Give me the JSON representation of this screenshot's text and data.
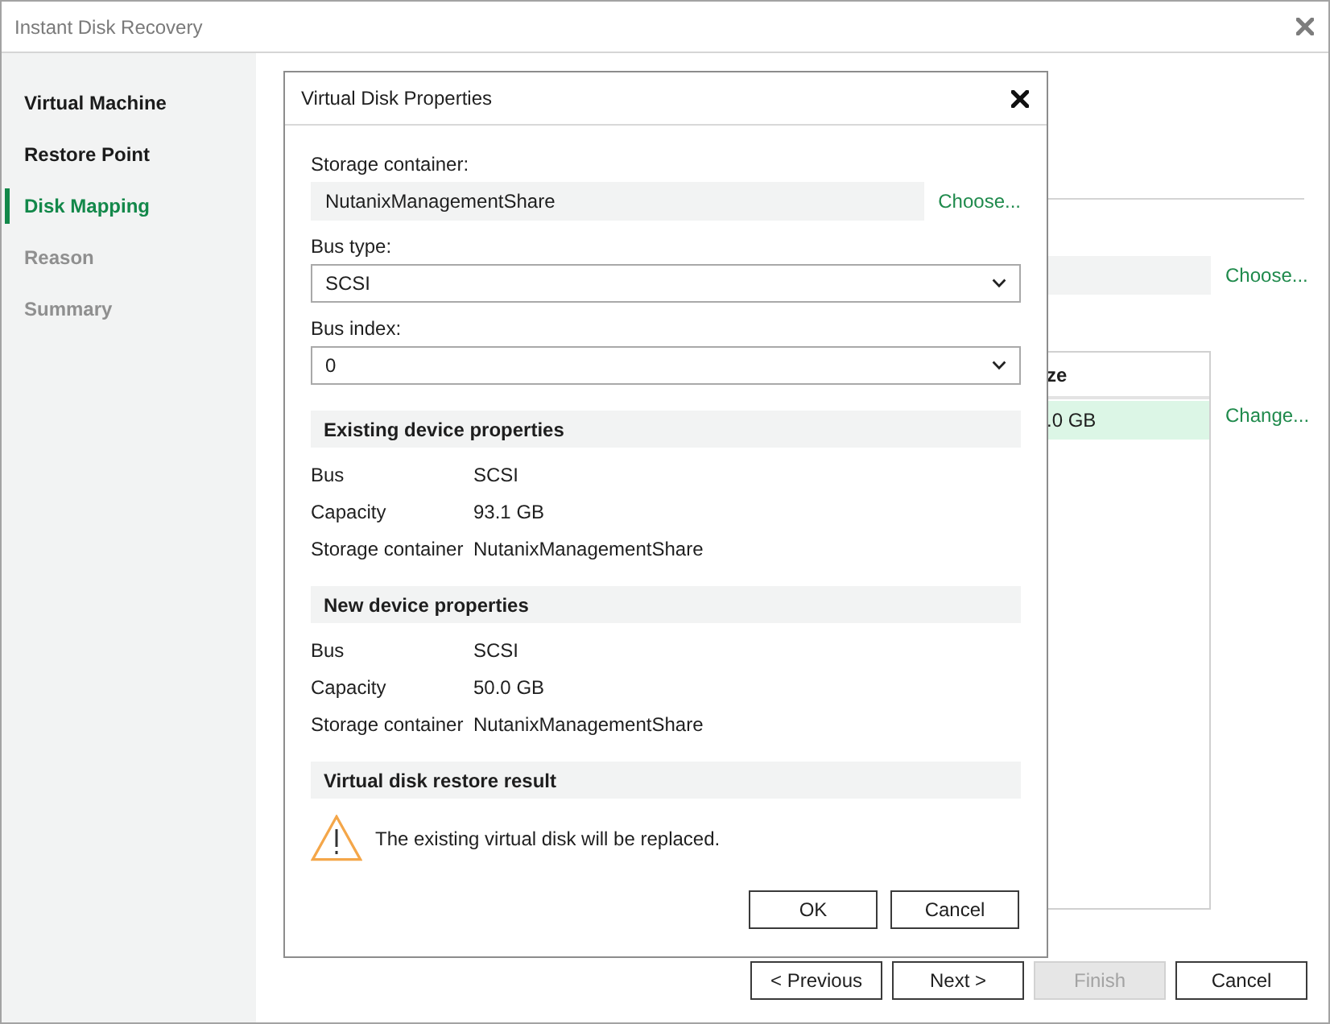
{
  "window": {
    "title": "Instant Disk Recovery"
  },
  "sidebar": {
    "items": [
      {
        "label": "Virtual Machine",
        "selected": false,
        "disabled": false
      },
      {
        "label": "Restore Point",
        "selected": false,
        "disabled": false
      },
      {
        "label": "Disk Mapping",
        "selected": true,
        "disabled": false
      },
      {
        "label": "Reason",
        "selected": false,
        "disabled": true
      },
      {
        "label": "Summary",
        "selected": false,
        "disabled": true
      }
    ]
  },
  "main": {
    "field_link": "Choose...",
    "table": {
      "columns": [
        "ze"
      ],
      "rows": [
        {
          "cells": [
            ".0 GB"
          ],
          "selected": true
        }
      ]
    },
    "table_link": "Change..."
  },
  "dialog": {
    "title": "Virtual Disk Properties",
    "fields": [
      {
        "kind": "readonly",
        "label": "Storage container:",
        "value": "NutanixManagementShare",
        "link": "Choose..."
      },
      {
        "kind": "select",
        "label": "Bus type:",
        "value": "SCSI"
      },
      {
        "kind": "select",
        "label": "Bus index:",
        "value": "0"
      }
    ],
    "sections": [
      {
        "kind": "properties",
        "title": "Existing device properties",
        "rows": [
          {
            "label": "Bus",
            "value": "SCSI"
          },
          {
            "label": "Capacity",
            "value": "93.1 GB"
          },
          {
            "label": "Storage container",
            "value": "NutanixManagementShare"
          }
        ]
      },
      {
        "kind": "properties",
        "title": "New device properties",
        "rows": [
          {
            "label": "Bus",
            "value": "SCSI"
          },
          {
            "label": "Capacity",
            "value": "50.0 GB"
          },
          {
            "label": "Storage container",
            "value": "NutanixManagementShare"
          }
        ]
      },
      {
        "kind": "warning",
        "title": "Virtual disk restore result",
        "message": "The existing virtual disk will be replaced."
      }
    ],
    "buttons": [
      {
        "label": "OK"
      },
      {
        "label": "Cancel"
      }
    ]
  },
  "buttons": [
    {
      "label": "< Previous",
      "disabled": false
    },
    {
      "label": "Next >",
      "disabled": false
    },
    {
      "label": "Finish",
      "disabled": true
    },
    {
      "label": "Cancel",
      "disabled": false
    }
  ]
}
